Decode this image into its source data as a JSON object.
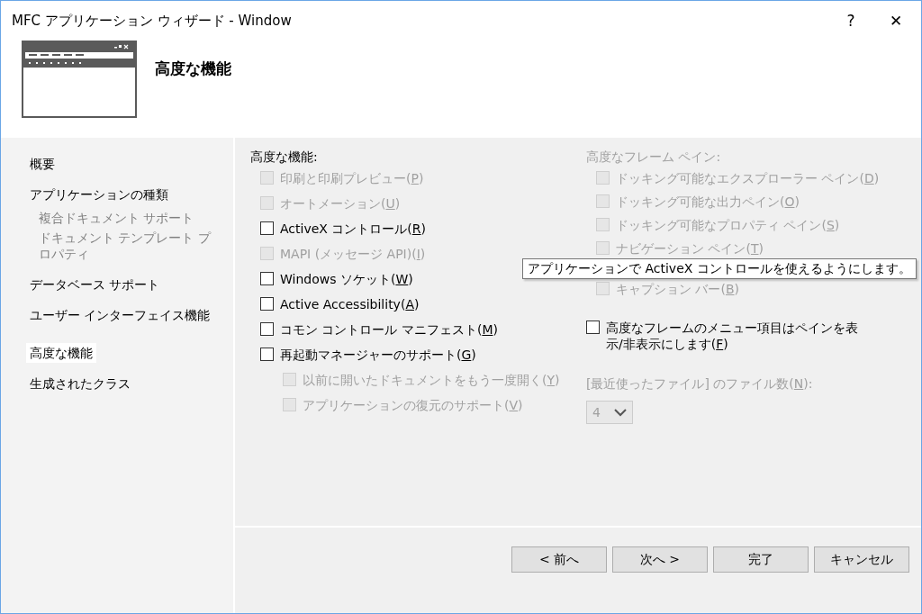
{
  "window": {
    "title": "MFC アプリケーション ウィザード - Window",
    "help": "?",
    "close": "✕"
  },
  "header": {
    "title": "高度な機能"
  },
  "sidebar": {
    "items": [
      {
        "label": "概要",
        "selected": false,
        "disabled": false
      },
      {
        "label": "アプリケーションの種類",
        "selected": false,
        "disabled": false,
        "children": [
          {
            "label": "複合ドキュメント サポート",
            "selected": false,
            "disabled": true
          },
          {
            "label": "ドキュメント テンプレート プロパティ",
            "selected": false,
            "disabled": true
          }
        ]
      },
      {
        "label": "データベース サポート",
        "selected": false,
        "disabled": false
      },
      {
        "label": "ユーザー インターフェイス機能",
        "selected": false,
        "disabled": false
      },
      {
        "label": "高度な機能",
        "selected": true,
        "disabled": false
      },
      {
        "label": "生成されたクラス",
        "selected": false,
        "disabled": false
      }
    ]
  },
  "features": {
    "label": "高度な機能:",
    "disabled": false,
    "options": [
      {
        "label": "印刷と印刷プレビュー(P)",
        "checked": false,
        "disabled": true
      },
      {
        "label": "オートメーション(U)",
        "checked": false,
        "disabled": true
      },
      {
        "label": "ActiveX コントロール(R)",
        "checked": false,
        "disabled": false
      },
      {
        "label": "MAPI (メッセージ API)(I)",
        "checked": false,
        "disabled": true
      },
      {
        "label": "Windows ソケット(W)",
        "checked": false,
        "disabled": false
      },
      {
        "label": "Active Accessibility(A)",
        "checked": false,
        "disabled": false
      },
      {
        "label": "コモン コントロール マニフェスト(M)",
        "checked": false,
        "disabled": false
      },
      {
        "label": "再起動マネージャーのサポート(G)",
        "checked": false,
        "disabled": false,
        "children": [
          {
            "label": "以前に開いたドキュメントをもう一度開く(Y)",
            "checked": false,
            "disabled": true
          },
          {
            "label": "アプリケーションの復元のサポート(V)",
            "checked": false,
            "disabled": true
          }
        ]
      }
    ]
  },
  "frame_panes": {
    "label": "高度なフレーム ペイン:",
    "disabled": true,
    "options": [
      {
        "label": "ドッキング可能なエクスプローラー ペイン(D)",
        "checked": false,
        "disabled": true
      },
      {
        "label": "ドッキング可能な出力ペイン(O)",
        "checked": false,
        "disabled": true
      },
      {
        "label": "ドッキング可能なプロパティ ペイン(S)",
        "checked": false,
        "disabled": true
      },
      {
        "label": "ナビゲーション ペイン(T)",
        "checked": false,
        "disabled": true
      },
      {
        "label": "キャプション バー(B)",
        "checked": false,
        "disabled": true
      }
    ]
  },
  "menu_toggle": {
    "label": "高度なフレームのメニュー項目はペインを表示/非表示にします(F)",
    "checked": false,
    "disabled": false
  },
  "recent_files": {
    "label": "[最近使ったファイル] のファイル数(N):",
    "value": "4",
    "disabled": true
  },
  "tooltip": {
    "text": "アプリケーションで ActiveX コントロールを使えるようにします。"
  },
  "buttons": [
    {
      "label": "< 前へ"
    },
    {
      "label": "次へ >"
    },
    {
      "label": "完了"
    },
    {
      "label": "キャンセル"
    }
  ]
}
